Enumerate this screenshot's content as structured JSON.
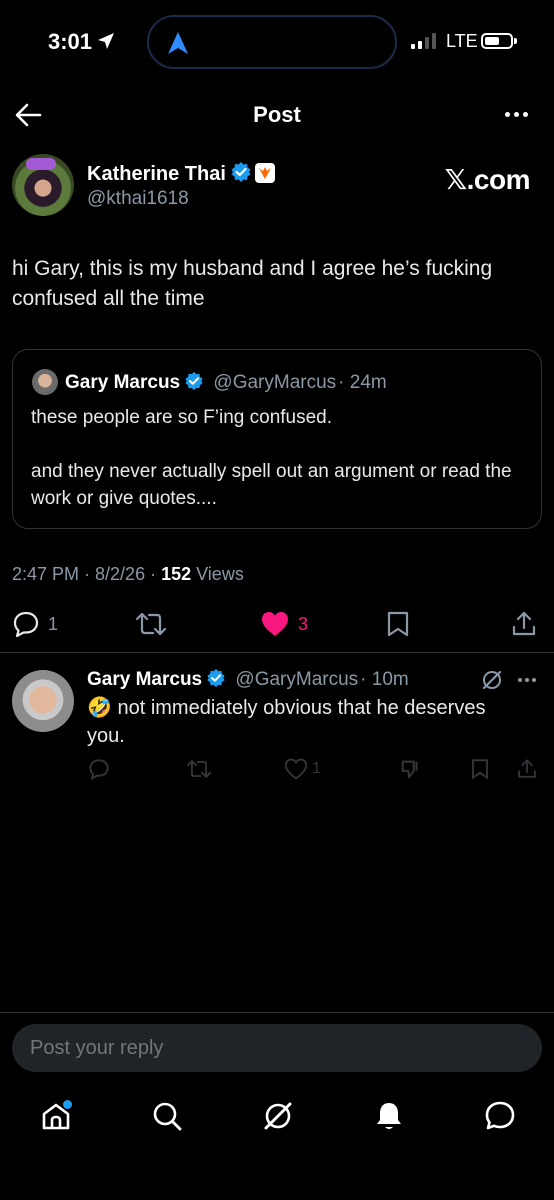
{
  "status_bar": {
    "time": "3:01",
    "network": "LTE"
  },
  "header": {
    "title": "Post"
  },
  "post": {
    "author_name": "Katherine Thai",
    "author_handle": "@kthai1618",
    "watermark": "𝕏.com",
    "text": "hi Gary, this is my husband and I agree he’s fucking confused all the time",
    "quote": {
      "author_name": "Gary Marcus",
      "author_handle": "@GaryMarcus",
      "time": "· 24m",
      "text": "these people are so F’ing confused.\n\nand they never actually spell out an argument or read the work or give quotes...."
    },
    "timestamp": "2:47 PM · 8/2/26 · ",
    "views_count": "152",
    "views_label": " Views",
    "actions": {
      "replies": "1",
      "likes": "3"
    }
  },
  "reply": {
    "author_name": "Gary Marcus",
    "author_handle": "@GaryMarcus",
    "time": "· 10m",
    "text": "🤣 not immediately obvious that he deserves you.",
    "likes": "1"
  },
  "composer": {
    "placeholder": "Post your reply"
  },
  "colors": {
    "accent": "#1d9bf0",
    "like": "#f91880",
    "background": "#000000",
    "secondary_text": "#8b98a5"
  }
}
